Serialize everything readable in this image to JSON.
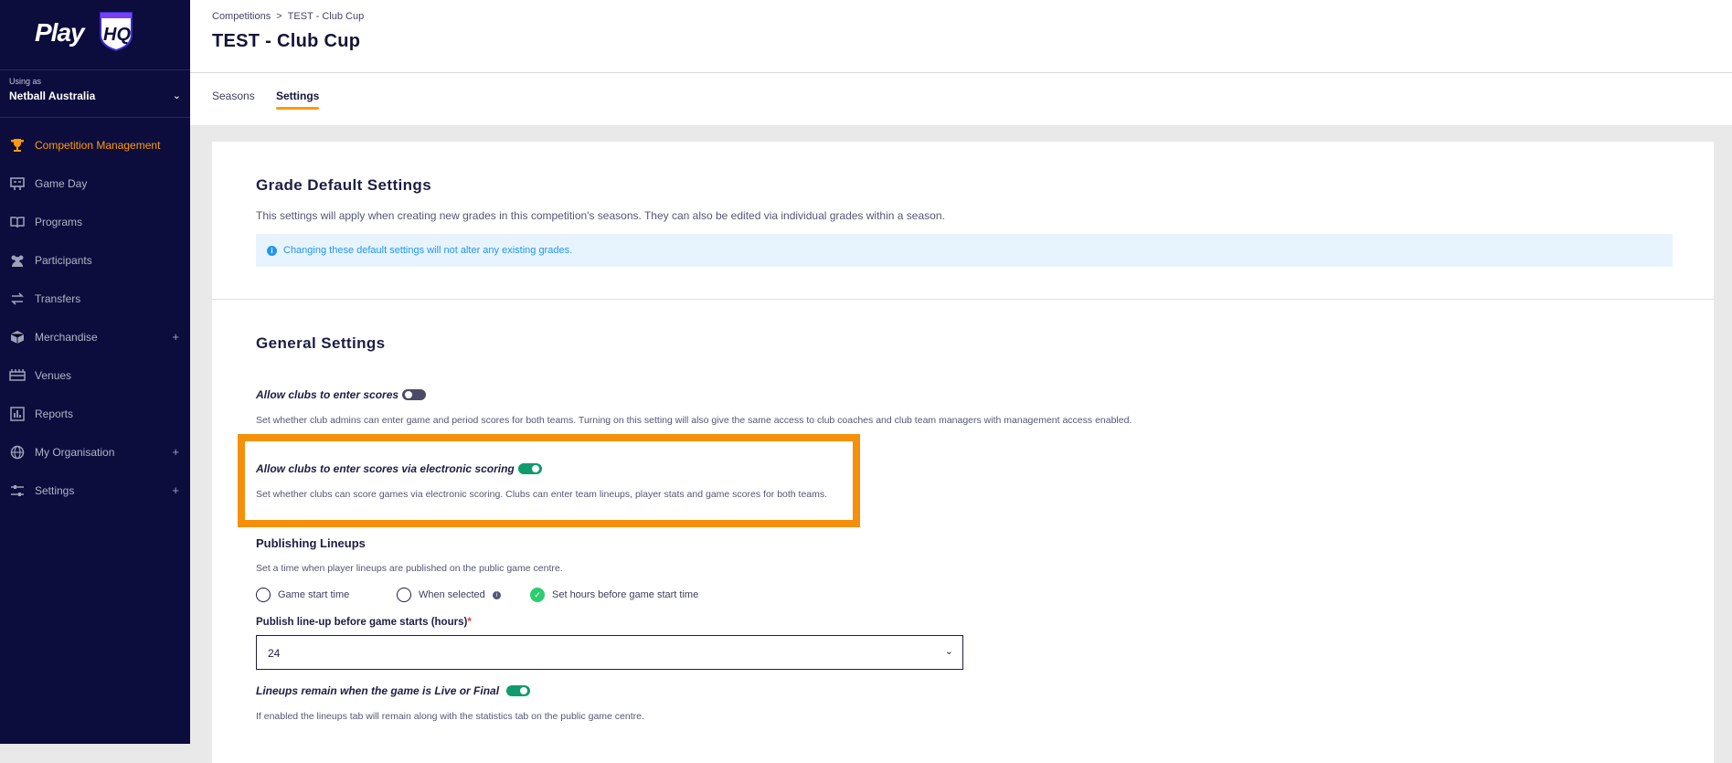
{
  "app": {
    "logo_text": "Play",
    "logo_badge": "HQ"
  },
  "org": {
    "using_as": "Using as",
    "name": "Netball Australia"
  },
  "nav": [
    {
      "label": "Competition Management",
      "icon": "trophy-icon",
      "active": true,
      "expandable": false
    },
    {
      "label": "Game Day",
      "icon": "scoreboard-icon",
      "active": false,
      "expandable": false
    },
    {
      "label": "Programs",
      "icon": "book-icon",
      "active": false,
      "expandable": false
    },
    {
      "label": "Participants",
      "icon": "people-icon",
      "active": false,
      "expandable": false
    },
    {
      "label": "Transfers",
      "icon": "transfer-icon",
      "active": false,
      "expandable": false
    },
    {
      "label": "Merchandise",
      "icon": "box-icon",
      "active": false,
      "expandable": true
    },
    {
      "label": "Venues",
      "icon": "stadium-icon",
      "active": false,
      "expandable": false
    },
    {
      "label": "Reports",
      "icon": "report-icon",
      "active": false,
      "expandable": false
    },
    {
      "label": "My Organisation",
      "icon": "globe-icon",
      "active": false,
      "expandable": true
    },
    {
      "label": "Settings",
      "icon": "sliders-icon",
      "active": false,
      "expandable": true
    }
  ],
  "breadcrumb": {
    "first": "Competitions",
    "separator": ">",
    "current": "TEST - Club Cup"
  },
  "page_title": "TEST - Club Cup",
  "tabs": [
    {
      "label": "Seasons"
    },
    {
      "label": "Settings"
    }
  ],
  "grade_defaults": {
    "title": "Grade Default Settings",
    "description": "This settings will apply when creating new grades in this competition's seasons. They can also be edited via individual grades within a season.",
    "info": "Changing these default settings will not alter any existing grades."
  },
  "general": {
    "title": "General Settings",
    "allow_scores_label": "Allow clubs to enter scores",
    "allow_scores_on": false,
    "allow_scores_desc": "Set whether club admins can enter game and period scores for both teams. Turning on this setting will also give the same access to club coaches and club team managers with management access enabled.",
    "electronic_label": "Allow clubs to enter scores via electronic scoring",
    "electronic_on": true,
    "electronic_desc": "Set whether clubs can score games via electronic scoring. Clubs can enter team lineups, player stats and game scores for both teams."
  },
  "lineups": {
    "title": "Publishing Lineups",
    "desc": "Set a time when player lineups are published on the public game centre.",
    "options": [
      "Game start time",
      "When selected",
      "Set hours before game start time"
    ],
    "selected": "Set hours before game start time",
    "hours_label": "Publish line-up before game starts (hours)",
    "required_mark": "*",
    "hours_value": "24",
    "remain_label": "Lineups remain when the game is Live or Final",
    "remain_on": true,
    "remain_desc": "If enabled the lineups tab will remain along with the statistics tab on the public game centre."
  },
  "colors": {
    "sidebar": "#0c0d3d",
    "accent": "#ff9a0e",
    "toggle_on": "#0f9b6c",
    "highlight": "#f5900b"
  }
}
